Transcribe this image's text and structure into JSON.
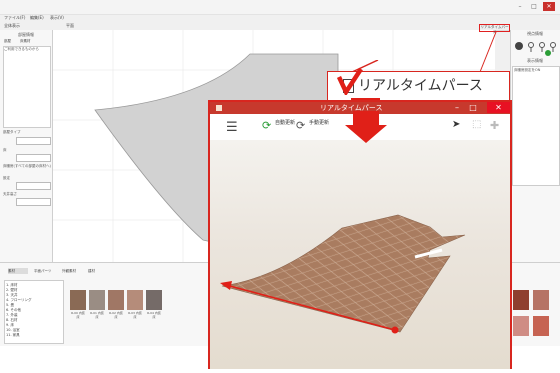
{
  "app": {
    "menu": [
      "ファイル(F)",
      "編集(E)",
      "表示(V)"
    ],
    "toolbar": [
      "全体表示",
      "平面"
    ],
    "left_panel": {
      "title": "部屋情報",
      "tabs": [
        "部屋",
        "床素材"
      ],
      "list_item": "ご利用できるものから",
      "labels": [
        "部屋タイプ",
        "床",
        "床暖房(すべての部屋の床材へ)",
        "設定",
        "天井高さ"
      ]
    },
    "right_panel": {
      "title": "視点情報",
      "section_title": "表示情報",
      "info_text": "床暖房設定をON"
    },
    "highlight_button_label": "リアルタイムパース",
    "bottom_panel": {
      "tabs": [
        "素材",
        "平面パーツ",
        "外観素材",
        "建材"
      ],
      "tree": [
        "1. 床材",
        "2. 壁材",
        "3. 天井",
        "4. フローリング",
        "5. 畳",
        "6. その他",
        "7. 外装",
        "8. 石材",
        "9. 床",
        "10. 浴室",
        "11. 家具"
      ],
      "textures": [
        {
          "label": "R-00 内装床",
          "color": "#8a6a55"
        },
        {
          "label": "R-01 内装床",
          "color": "#9a8d84"
        },
        {
          "label": "R-02 内装床",
          "color": "#a07765"
        },
        {
          "label": "R-03 内装床",
          "color": "#b58c7a"
        },
        {
          "label": "R-04 内装床",
          "color": "#756b68"
        }
      ],
      "right_textures": [
        {
          "color": "#8f3f2f"
        },
        {
          "color": "#b67365"
        },
        {
          "color": "#cf8c84"
        },
        {
          "color": "#c66352"
        }
      ]
    }
  },
  "callout": {
    "label": "リアルタイムパース",
    "checked": false
  },
  "realtime_window": {
    "title": "リアルタイムパース",
    "controls": [
      "–",
      "□",
      "✕"
    ],
    "toolbar": {
      "auto_label": "自動更新",
      "manual_label": "手動更新"
    }
  },
  "colors": {
    "accent_red": "#d8261f",
    "titlebar_red": "#c7392d",
    "auto_green": "#2a9d36",
    "floor_tile": "#b58a6e"
  },
  "icons": [
    "menu-icon",
    "refresh-icon",
    "manual-refresh-icon",
    "cursor-icon",
    "select-icon",
    "move-icon",
    "check-mark-icon",
    "down-arrow-icon"
  ]
}
